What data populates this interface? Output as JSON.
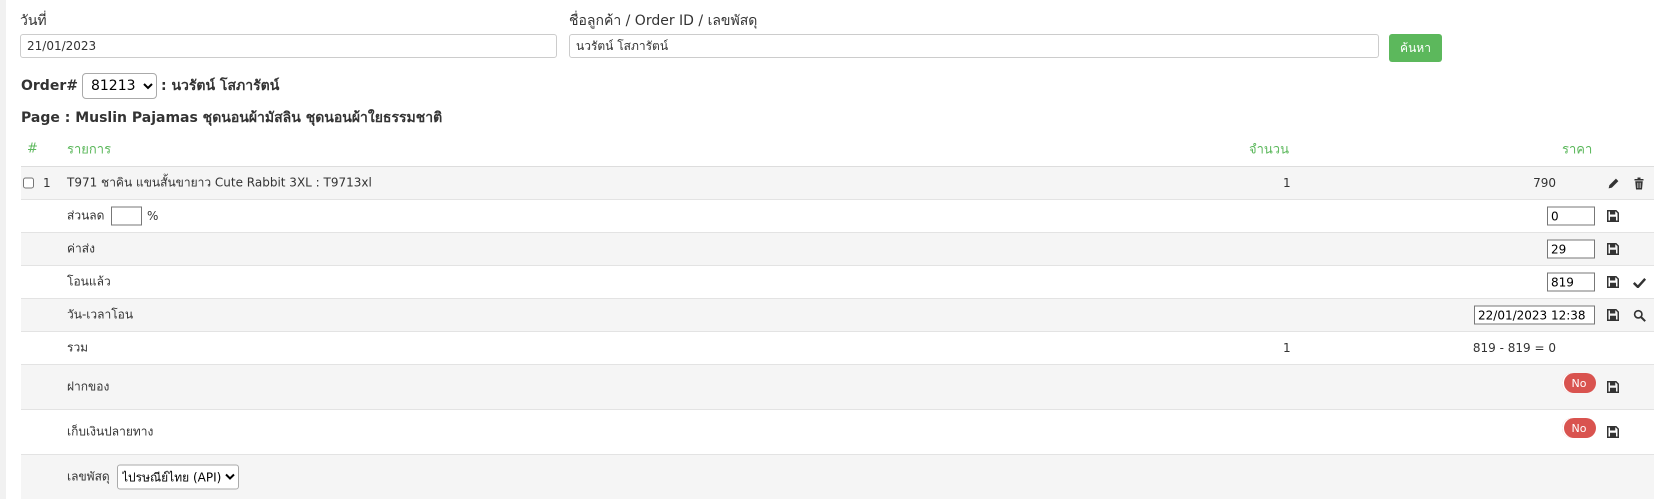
{
  "search": {
    "date_label": "วันที่",
    "date_value": "21/01/2023",
    "customer_label": "ชื่อลูกค้า / Order ID / เลขพัสดุ",
    "customer_value": "นวรัตน์ โสภารัตน์",
    "search_button": "ค้นหา"
  },
  "order": {
    "prefix": "Order#",
    "number": "81213",
    "customer_suffix": ": นวรัตน์ โสภารัตน์",
    "page_line": "Page : Muslin Pajamas ชุดนอนผ้ามัสลิน ชุดนอนผ้าใยธรรมชาติ"
  },
  "table": {
    "headers": {
      "num": "#",
      "item": "รายการ",
      "qty": "จำนวน",
      "price": "ราคา"
    },
    "item": {
      "index": "1",
      "name": "T971 ชาคิน แขนสั้นขายาว Cute Rabbit 3XL : T9713xl",
      "qty": "1",
      "price": "790"
    },
    "discount": {
      "label": "ส่วนลด",
      "unit": "%",
      "value": "0"
    },
    "shipping": {
      "label": "ค่าส่ง",
      "value": "29"
    },
    "transferred": {
      "label": "โอนแล้ว",
      "value": "819"
    },
    "transfer_time": {
      "label": "วัน-เวลาโอน",
      "value": "22/01/2023 12:38"
    },
    "total": {
      "label": "รวม",
      "qty": "1",
      "value": "819 - 819 = 0"
    },
    "deposit": {
      "label": "ฝากของ",
      "toggle": "No"
    },
    "cod": {
      "label": "เก็บเงินปลายทาง",
      "toggle": "No"
    },
    "tracking": {
      "label": "เลขพัสดุ",
      "carrier": "ไปรษณีย์ไทย (API)"
    }
  },
  "colors": {
    "accent": "#5cb85c",
    "toggle_off": "#d9534f"
  }
}
